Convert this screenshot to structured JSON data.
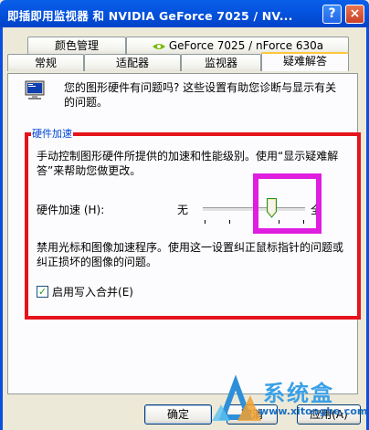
{
  "window": {
    "title": "即插即用监视器 和 NVIDIA GeForce 7025 / NV...",
    "help_glyph": "?",
    "close_glyph": "×"
  },
  "tabs_row1": [
    "颜色管理",
    "GeForce 7025 / nForce 630a"
  ],
  "tabs_row2": [
    "常规",
    "适配器",
    "监视器",
    "疑难解答"
  ],
  "active_tab": "疑难解答",
  "intro_text": "您的图形硬件有问题吗? 这些设置有助您诊断与显示有关的问题。",
  "hardware_accel": {
    "group_label": "硬件加速",
    "description": "手动控制图形硬件所提供的加速和性能级别。使用“显示疑难解答”来帮助您做更改。",
    "label_text": "硬件加速",
    "label_mnemonic": "(H):",
    "min_label": "无",
    "max_label": "全",
    "slider_level_fraction": 0.8,
    "level_description": "禁用光标和图像加速程序。使用这一设置纠正鼠标指针的问题或纠正损坏的图像的问题。"
  },
  "write_combining": {
    "label": "启用写入合并",
    "mnemonic": "(E)",
    "checked": true
  },
  "buttons": {
    "ok": "确定",
    "cancel": "取消",
    "apply": "应用(A)"
  },
  "watermark": {
    "title": "系统盒",
    "url": "www.xitonghe.com"
  },
  "colors": {
    "title_bar": "#0454E0",
    "annotation_red": "#E5131B",
    "annotation_magenta": "#E01EE0",
    "group_label": "#0046D5"
  },
  "icons": [
    "monitor-icon",
    "help-icon",
    "close-icon",
    "slider-thumb",
    "checkmark-icon",
    "watermark-logo-icon"
  ]
}
